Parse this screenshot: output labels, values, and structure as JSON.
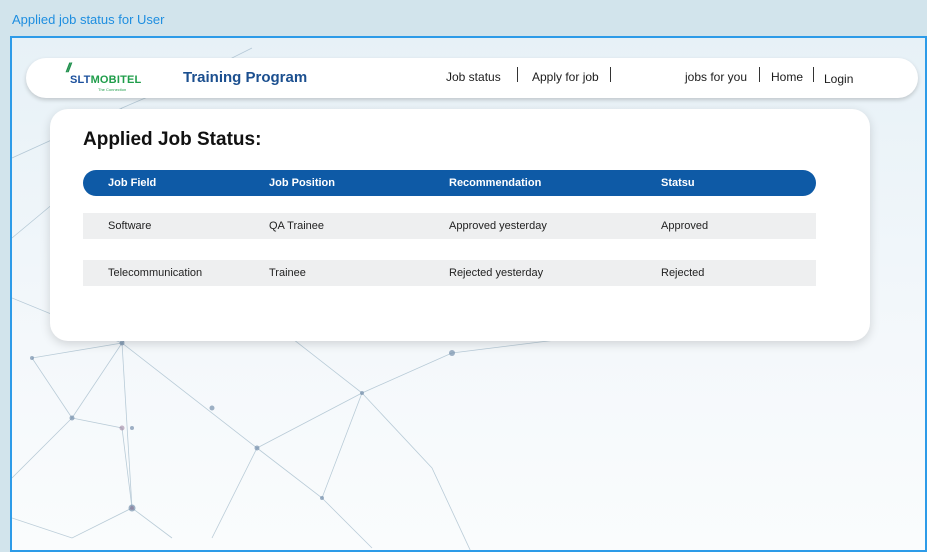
{
  "frame": {
    "title": "Applied job status for User"
  },
  "navbar": {
    "logo": {
      "mark": "//",
      "brand_prefix": "SLT",
      "brand_suffix": "MOBITEL",
      "tagline": "The Connection"
    },
    "title": "Training Program",
    "links": {
      "job_status": "Job status",
      "apply_for_job": "Apply for job",
      "jobs_for_you": "jobs for you",
      "home": "Home",
      "login": "Login"
    }
  },
  "main": {
    "heading": "Applied Job Status:",
    "table": {
      "headers": [
        "Job  Field",
        "Job Position",
        "Recommendation",
        "Statsu"
      ],
      "rows": [
        [
          "Software",
          "QA Trainee",
          "Approved yesterday",
          "Approved"
        ],
        [
          "Telecommunication",
          "Trainee",
          "Rejected yesterday",
          "Rejected"
        ]
      ]
    }
  },
  "colors": {
    "accent": "#0e5aa6",
    "frame_border": "#2d9be8",
    "title_blue": "#1b4f8f",
    "row_bg": "#eeeff0"
  }
}
